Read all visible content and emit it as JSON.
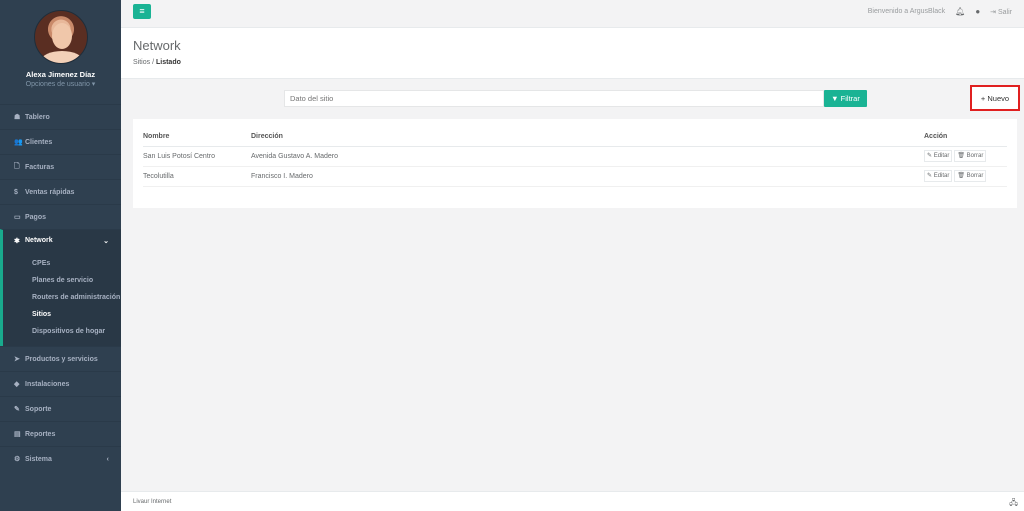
{
  "sidebar": {
    "profile_name": "Alexa Jimenez Díaz",
    "profile_options": "Opciones de usuario ▾",
    "items": [
      {
        "icon": "dashboard-icon",
        "glyph": "☗",
        "label": "Tablero"
      },
      {
        "icon": "users-icon",
        "glyph": "👥",
        "label": "Clientes"
      },
      {
        "icon": "file-icon",
        "glyph": "🗋",
        "label": "Facturas"
      },
      {
        "icon": "dollar-icon",
        "glyph": "$",
        "label": "Ventas rápidas"
      },
      {
        "icon": "money-icon",
        "glyph": "▭",
        "label": "Pagos"
      },
      {
        "icon": "network-icon",
        "glyph": "✱",
        "label": "Network",
        "caret": "⌄"
      },
      {
        "icon": "tag-icon",
        "glyph": "➤",
        "label": "Productos y servicios"
      },
      {
        "icon": "install-icon",
        "glyph": "◆",
        "label": "Instalaciones"
      },
      {
        "icon": "wrench-icon",
        "glyph": "✎",
        "label": "Soporte"
      },
      {
        "icon": "report-icon",
        "glyph": "▤",
        "label": "Reportes"
      },
      {
        "icon": "cogs-icon",
        "glyph": "⚙",
        "label": "Sistema",
        "caret": "‹"
      }
    ],
    "subitems": [
      "CPEs",
      "Planes de servicio",
      "Routers de administración",
      "Sitios",
      "Dispositivos de hogar"
    ]
  },
  "topbar": {
    "menu_glyph": "≡",
    "welcome": "Bienvenido a ArgusBlack",
    "logout": "Salir"
  },
  "heading": {
    "title": "Network",
    "crumb_parent": "Sitios",
    "crumb_sep": "/",
    "crumb_current": "Listado"
  },
  "filter": {
    "placeholder": "Dato del sitio",
    "filter_label": "▼ Filtrar",
    "new_label": "+ Nuevo"
  },
  "table": {
    "headers": [
      "Nombre",
      "Dirección",
      "Acción"
    ],
    "rows": [
      [
        "San Luis Potosí Centro",
        "Avenida Gustavo A. Madero"
      ],
      [
        "Tecolutilla",
        "Francisco I. Madero"
      ]
    ],
    "edit_label": "✎ Editar",
    "delete_label": "🗑 Borrar"
  },
  "footer": {
    "text": "Livaur Internet"
  },
  "colors": {
    "sidebar": "#2f4050",
    "accent": "#1ab394",
    "highlight_border": "#e02020"
  }
}
